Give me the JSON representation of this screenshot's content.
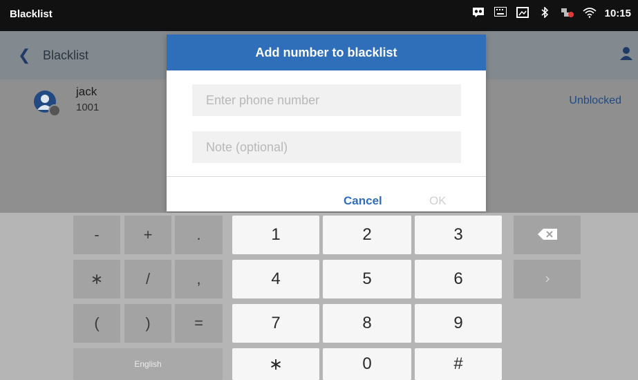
{
  "statusbar": {
    "title": "Blacklist",
    "clock": "10:15"
  },
  "appbar": {
    "back": "❮",
    "title": "Blacklist"
  },
  "contact": {
    "name": "jack",
    "number": "1001",
    "action": "Unblocked"
  },
  "dialog": {
    "title": "Add number to blacklist",
    "phone_placeholder": "Enter phone number",
    "note_placeholder": "Note (optional)",
    "cancel": "Cancel",
    "ok": "OK"
  },
  "keyboard": {
    "row1": [
      "-",
      "+",
      ".",
      "1",
      "2",
      "3"
    ],
    "row2": [
      "∗",
      "/",
      ",",
      "4",
      "5",
      "6"
    ],
    "row3": [
      "(",
      ")",
      "=",
      "7",
      "8",
      "9"
    ],
    "row4": [
      "English",
      "∗",
      "0",
      "#"
    ]
  }
}
